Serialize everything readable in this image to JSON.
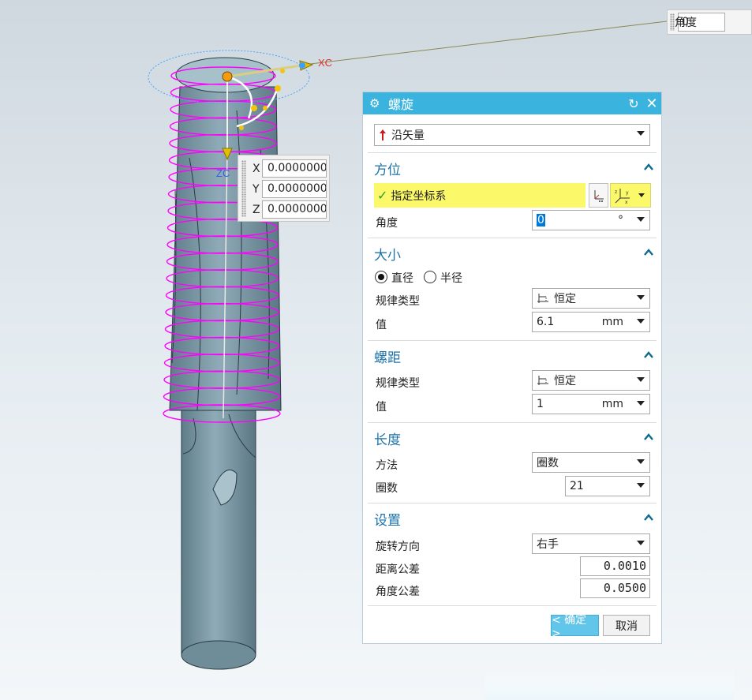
{
  "viewport": {
    "axis_labels": {
      "xc": "XC",
      "zc": "ZC"
    },
    "float_angle": {
      "label": "角度",
      "value": "0"
    },
    "coords": [
      {
        "axis": "X",
        "value": "0.0000000"
      },
      {
        "axis": "Y",
        "value": "0.0000000"
      },
      {
        "axis": "Z",
        "value": "0.0000000"
      }
    ],
    "colors": {
      "helix": "#ff00ff",
      "body": "#7b9aa7",
      "xc_label": "#e03030",
      "zc_label": "#3060e0"
    }
  },
  "dialog": {
    "title": "螺旋",
    "icons": {
      "title": "gear-icon",
      "reset": "reset-icon",
      "close": "close-icon"
    },
    "type": {
      "value": "沿矢量",
      "icon": "vector-arrow-icon"
    },
    "orientation": {
      "header": "方位",
      "specify_csys": "指定坐标系",
      "angle_label": "角度",
      "angle_value": "0",
      "angle_unit": "°"
    },
    "size": {
      "header": "大小",
      "radio_diameter": "直径",
      "radio_radius": "半径",
      "selected": "直径",
      "law_type_label": "规律类型",
      "law_type_value": "恒定",
      "value_label": "值",
      "value": "6.1",
      "unit": "mm"
    },
    "pitch": {
      "header": "螺距",
      "law_type_label": "规律类型",
      "law_type_value": "恒定",
      "value_label": "值",
      "value": "1",
      "unit": "mm"
    },
    "length": {
      "header": "长度",
      "method_label": "方法",
      "method_value": "圈数",
      "turns_label": "圈数",
      "turns_value": "21"
    },
    "settings": {
      "header": "设置",
      "rotation_label": "旋转方向",
      "rotation_value": "右手",
      "dist_tol_label": "距离公差",
      "dist_tol_value": "0.0010",
      "angle_tol_label": "角度公差",
      "angle_tol_value": "0.0500"
    },
    "buttons": {
      "ok": "< 确定 >",
      "cancel": "取消"
    },
    "colors": {
      "titlebar": "#3ab4de",
      "highlight": "#fbf86a",
      "section": "#1e73a8",
      "ok": "#62c6ea"
    }
  }
}
